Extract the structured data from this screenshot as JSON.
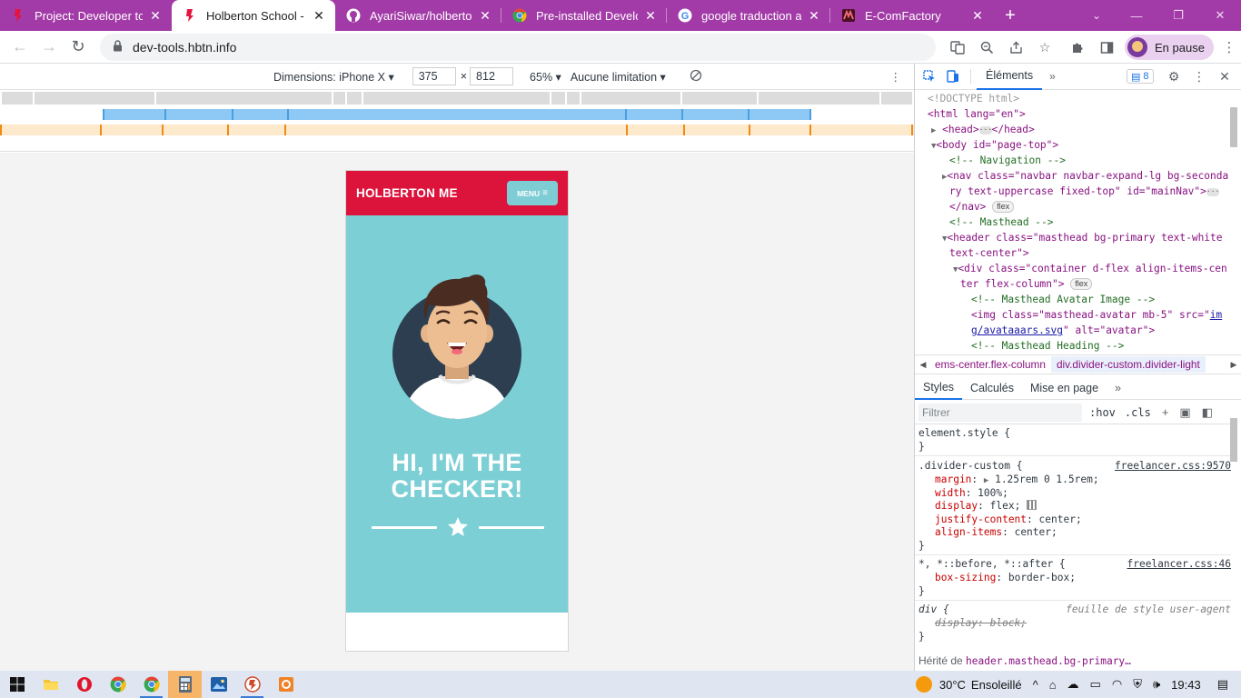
{
  "browser": {
    "tabs": [
      {
        "title": "Project: Developer to",
        "favicon": "holberton-icon"
      },
      {
        "title": "Holberton School - De",
        "favicon": "holberton-icon",
        "active": true
      },
      {
        "title": "AyariSiwar/holbertons",
        "favicon": "github-icon"
      },
      {
        "title": "Pre-installed Develope",
        "favicon": "chrome-icon"
      },
      {
        "title": "google traduction ang",
        "favicon": "google-icon"
      },
      {
        "title": "E-ComFactory",
        "favicon": "ecomfactory-icon"
      }
    ],
    "url": "dev-tools.hbtn.info",
    "profile_label": "En pause"
  },
  "device_toolbar": {
    "dimensions_label": "Dimensions: iPhone X",
    "width": "375",
    "height": "812",
    "times": "×",
    "zoom": "65%",
    "throttle": "Aucune limitation"
  },
  "page": {
    "brand": "HOLBERTON ME",
    "menu_label": "MENU",
    "headline_line1": "HI, I'M THE",
    "headline_line2": "CHECKER!",
    "colors": {
      "navbar": "#dc143c",
      "masthead": "#7ccfd5"
    }
  },
  "devtools": {
    "panel_tab": "Éléments",
    "issues_count": "8",
    "dom": {
      "doctype": "<!DOCTYPE html>",
      "html_open": "<html lang=\"en\">",
      "head": "<head>",
      "head_close": "</head>",
      "body_open": "<body id=\"page-top\">",
      "comment_nav": "<!-- Navigation -->",
      "nav_line1": "<nav class=\"navbar navbar-expand-lg bg-seconda",
      "nav_line2": "ry text-uppercase fixed-top\" id=\"mainNav\">",
      "nav_close": "</nav>",
      "flex_pill": "flex",
      "comment_masthead": "<!-- Masthead -->",
      "header_line1": "<header class=\"masthead bg-primary text-white",
      "header_line2": "text-center\">",
      "div_line1": "<div class=\"container d-flex align-items-cen",
      "div_line2": "ter flex-column\">",
      "comment_avatar": "<!-- Masthead Avatar Image -->",
      "img_line1": "<img class=\"masthead-avatar mb-5\" src=\"",
      "img_src1": "im",
      "img_src2": "g/avataaars.svg",
      "img_line2": "\" alt=\"avatar\">",
      "comment_heading": "<!-- Masthead Heading -->"
    },
    "breadcrumbs": [
      "ems-center.flex-column",
      "div.divider-custom.divider-light"
    ],
    "style_tabs": [
      "Styles",
      "Calculés",
      "Mise en page"
    ],
    "filter_placeholder": "Filtrer",
    "filter_hov": ":hov",
    "filter_cls": ".cls",
    "rules": {
      "element_style": "element.style {",
      "close": "}",
      "divider_selector": ".divider-custom {",
      "divider_source": "freelancer.css:9570",
      "margin_prop": "margin",
      "margin_val": "1.25rem 0 1.5rem;",
      "width_prop": "width",
      "width_val": "100%;",
      "display_prop": "display",
      "display_val": "flex;",
      "justify_prop": "justify-content",
      "justify_val": "center;",
      "align_prop": "align-items",
      "align_val": "center;",
      "universal_selector": "*, *::before, *::after {",
      "universal_source": "freelancer.css:46",
      "boxsizing_prop": "box-sizing",
      "boxsizing_val": "border-box;",
      "div_selector": "div {",
      "ua_label": "feuille de style user-agent",
      "ua_display": "display: block;"
    },
    "inherited_label": "Hérité de",
    "inherited_from": "header.masthead.bg-primary…"
  },
  "taskbar": {
    "weather_temp": "30°C",
    "weather_text": "Ensoleillé",
    "time": "19:43"
  }
}
